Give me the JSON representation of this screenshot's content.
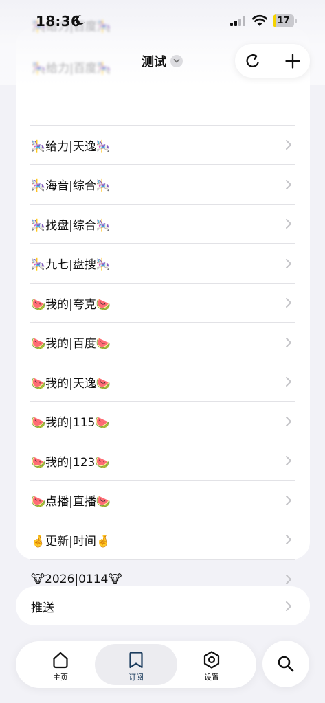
{
  "status_bar": {
    "time": "18:36",
    "battery_level": "17",
    "battery_fraction": 0.17,
    "signal_bars_active": 2,
    "signal_bars_total": 4
  },
  "header": {
    "title": "测试",
    "ghost_items": [
      "🎠给力|百度🎠",
      "🎠给力|百度🎠"
    ]
  },
  "list": {
    "items": [
      {
        "label": "🎠给力|天逸🎠"
      },
      {
        "label": "🎠海音|综合🎠"
      },
      {
        "label": "🎠找盘|综合🎠"
      },
      {
        "label": "🎠九七|盘搜🎠"
      },
      {
        "label": "🍉我的|夸克🍉"
      },
      {
        "label": "🍉我的|百度🍉"
      },
      {
        "label": "🍉我的|天逸🍉"
      },
      {
        "label": "🍉我的|115🍉"
      },
      {
        "label": "🍉我的|123🍉"
      },
      {
        "label": "🍉点播|直播🍉"
      },
      {
        "label": "🤞更新|时间🤞"
      },
      {
        "label": "🐮2026|0114🐮"
      }
    ]
  },
  "push": {
    "label": "推送"
  },
  "tab_bar": {
    "tabs": [
      {
        "label": "主页",
        "icon": "home-icon"
      },
      {
        "label": "订阅",
        "icon": "bookmark-icon",
        "active": true
      },
      {
        "label": "设置",
        "icon": "hexagon-settings-icon"
      }
    ]
  },
  "colors": {
    "background": "#f2f2f7",
    "card": "#ffffff",
    "accent_tab_icon": "#1c3d5e",
    "battery_fill": "#f5d300"
  }
}
